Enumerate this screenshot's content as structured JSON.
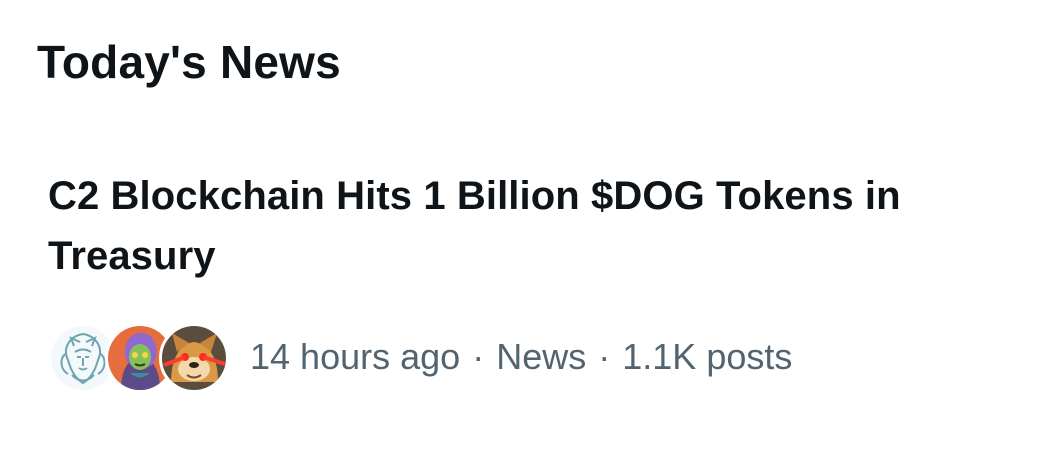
{
  "section": {
    "title": "Today's News"
  },
  "story": {
    "headline": "C2 Blockchain Hits 1 Billion $DOG Tokens in Treasury",
    "time": "14 hours ago",
    "category": "News",
    "posts": "1.1K posts",
    "separator": "·",
    "avatars": [
      {
        "icon": "lion-logo-avatar"
      },
      {
        "icon": "hooded-character-avatar"
      },
      {
        "icon": "dog-laser-eyes-avatar"
      }
    ]
  },
  "colors": {
    "primary_text": "#0f1419",
    "secondary_text": "#536471",
    "background": "#ffffff"
  }
}
